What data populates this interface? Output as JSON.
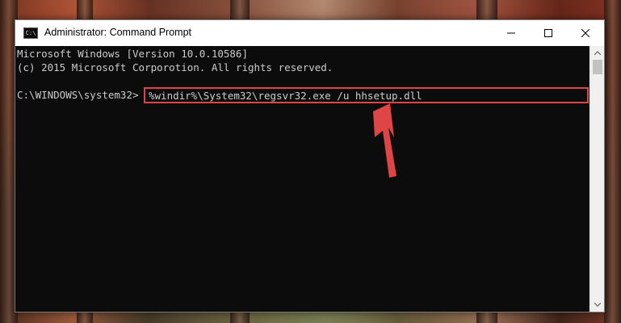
{
  "window": {
    "title": "Administrator: Command Prompt",
    "icon": "console-app-icon",
    "icon_glyph": "C:\\",
    "controls": {
      "minimize_icon": "minimize-icon",
      "maximize_icon": "maximize-icon",
      "close_icon": "close-icon"
    }
  },
  "console": {
    "lines": [
      "Microsoft Windows [Version 10.0.10586]",
      "(c) 2015 Microsoft Corporotion. All rights reserved."
    ],
    "prompt": "C:\\WINDOWS\\system32>",
    "command": "%windir%\\System32\\regsvr32.exe /u hhsetup.dll"
  },
  "annotation": {
    "highlight_color": "#e04545",
    "arrow_color": "#e04545",
    "arrow_icon": "red-arrow-icon"
  },
  "colors": {
    "console_bg": "#0c0c0c",
    "console_text": "#cccccc",
    "titlebar_bg": "#ffffff"
  }
}
